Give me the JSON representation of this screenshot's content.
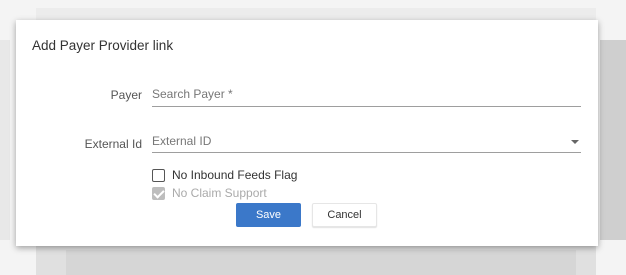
{
  "dialog": {
    "title": "Add Payer Provider link",
    "payer": {
      "label": "Payer",
      "placeholder": "Search Payer *",
      "value": ""
    },
    "external_id": {
      "label": "External Id",
      "selected": "External ID"
    },
    "no_inbound_feeds": {
      "label": "No Inbound Feeds Flag",
      "checked": false
    },
    "no_claim_support": {
      "label": "No Claim Support",
      "checked": true,
      "disabled": true
    },
    "save_label": "Save",
    "cancel_label": "Cancel"
  },
  "colors": {
    "primary_button": "#3b78c9",
    "disabled_check": "#bdbdbd"
  },
  "icons": {
    "dropdown": "chevron-down-icon",
    "checkmark": "checkmark-icon"
  }
}
